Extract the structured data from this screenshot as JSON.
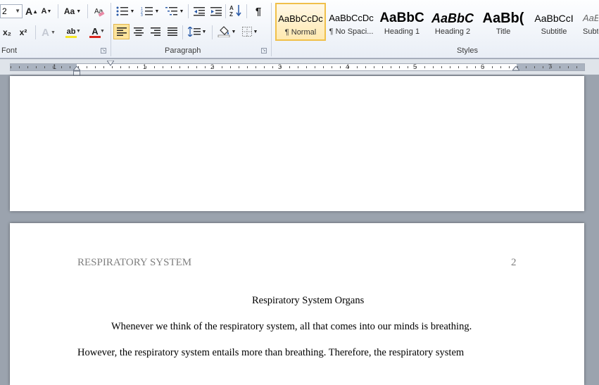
{
  "font_group": {
    "size_value": "2",
    "label": "Font",
    "grow_font": "A",
    "shrink_font": "A",
    "change_case": "Aa",
    "subscript": "x₂",
    "superscript": "x²",
    "text_effects": "A",
    "highlight": "ab",
    "font_color": "A",
    "font_color_hex": "#d8261e",
    "highlight_hex": "#f5e626"
  },
  "paragraph_group": {
    "label": "Paragraph",
    "show_marks": "¶"
  },
  "styles_group": {
    "label": "Styles",
    "items": [
      {
        "preview": "AaBbCcDc",
        "name": "¶ Normal"
      },
      {
        "preview": "AaBbCcDc",
        "name": "¶ No Spaci..."
      },
      {
        "preview": "AaBbC",
        "name": "Heading 1"
      },
      {
        "preview": "AaBbC",
        "name": "Heading 2"
      },
      {
        "preview": "AaBb(",
        "name": "Title"
      },
      {
        "preview": "AaBbCcI",
        "name": "Subtitle"
      },
      {
        "preview": "AaBl",
        "name": "Subtl"
      }
    ]
  },
  "ruler": {
    "numbers": [
      "1",
      "1",
      "2",
      "3",
      "4",
      "5",
      "6",
      "7"
    ]
  },
  "document": {
    "header_title": "RESPIRATORY SYSTEM",
    "page_number": "2",
    "heading": "Respiratory System Organs",
    "line1": "Whenever we think of the respiratory system, all that comes into our minds is breathing.",
    "line2": "However, the respiratory system entails more than breathing. Therefore, the respiratory system"
  }
}
